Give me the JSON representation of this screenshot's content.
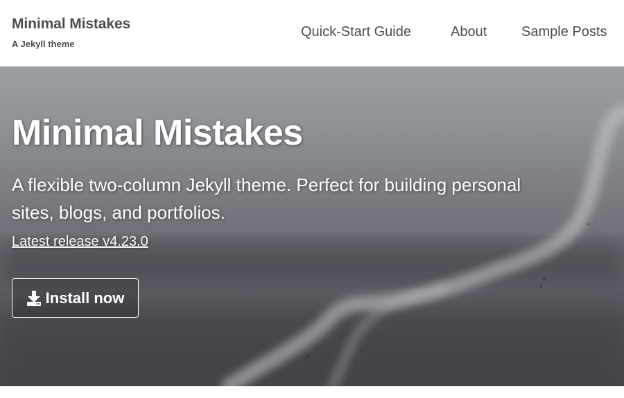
{
  "masthead": {
    "site_title": "Minimal Mistakes",
    "site_subtitle": "A Jekyll theme",
    "nav": [
      {
        "label": "Quick-Start Guide"
      },
      {
        "label": "About"
      },
      {
        "label": "Sample Posts"
      }
    ]
  },
  "hero": {
    "title": "Minimal Mistakes",
    "excerpt": "A flexible two-column Jekyll theme. Perfect for building personal sites, blogs, and portfolios.",
    "release_link": "Latest release v4.23.0",
    "cta": {
      "label": "Install now",
      "icon": "download-icon"
    }
  },
  "colors": {
    "text_dark": "#494e52",
    "hero_text": "#ffffff"
  }
}
